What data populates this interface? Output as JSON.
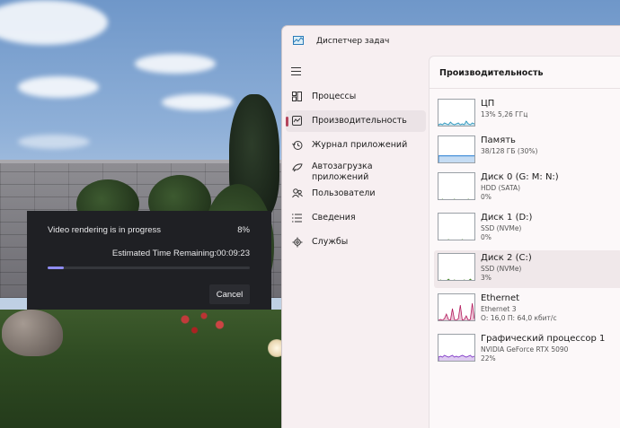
{
  "render_dialog": {
    "title": "Video rendering is in progress",
    "percent_text": "8%",
    "progress": 0.08,
    "eta": "Estimated Time Remaining:00:09:23",
    "cancel_label": "Cancel"
  },
  "task_manager": {
    "title": "Диспетчер задач",
    "nav": [
      {
        "label": "Процессы",
        "icon": "processes-icon"
      },
      {
        "label": "Производительность",
        "icon": "performance-icon",
        "active": true
      },
      {
        "label": "Журнал приложений",
        "icon": "app-history-icon"
      },
      {
        "label": "Автозагрузка\nприложений",
        "icon": "startup-apps-icon"
      },
      {
        "label": "Пользователи",
        "icon": "users-icon"
      },
      {
        "label": "Сведения",
        "icon": "details-icon"
      },
      {
        "label": "Службы",
        "icon": "services-icon"
      }
    ],
    "performance": {
      "header": "Производительность",
      "items": [
        {
          "name": "ЦП",
          "sub1": "13% 5,26 ГГц",
          "sub2": "",
          "color": "#1f8fb8"
        },
        {
          "name": "Память",
          "sub1": "38/128 ГБ (30%)",
          "sub2": "",
          "color": "#1f7ad1",
          "fill": 0.3
        },
        {
          "name": "Диск 0 (G: M: N:)",
          "sub1": "HDD (SATA)",
          "sub2": "0%",
          "color": "#4c8a2e"
        },
        {
          "name": "Диск 1 (D:)",
          "sub1": "SSD (NVMe)",
          "sub2": "0%",
          "color": "#4c8a2e"
        },
        {
          "name": "Диск 2 (C:)",
          "sub1": "SSD (NVMe)",
          "sub2": "3%",
          "color": "#4c8a2e",
          "selected": true
        },
        {
          "name": "Ethernet",
          "sub1": "Ethernet 3",
          "sub2": "О: 16,0 П: 64,0 кбит/с",
          "color": "#b3195c"
        },
        {
          "name": "Графический процессор 1",
          "sub1": "NVIDIA GeForce RTX 5090",
          "sub2": "22%",
          "color": "#7a2fc4"
        }
      ]
    }
  }
}
